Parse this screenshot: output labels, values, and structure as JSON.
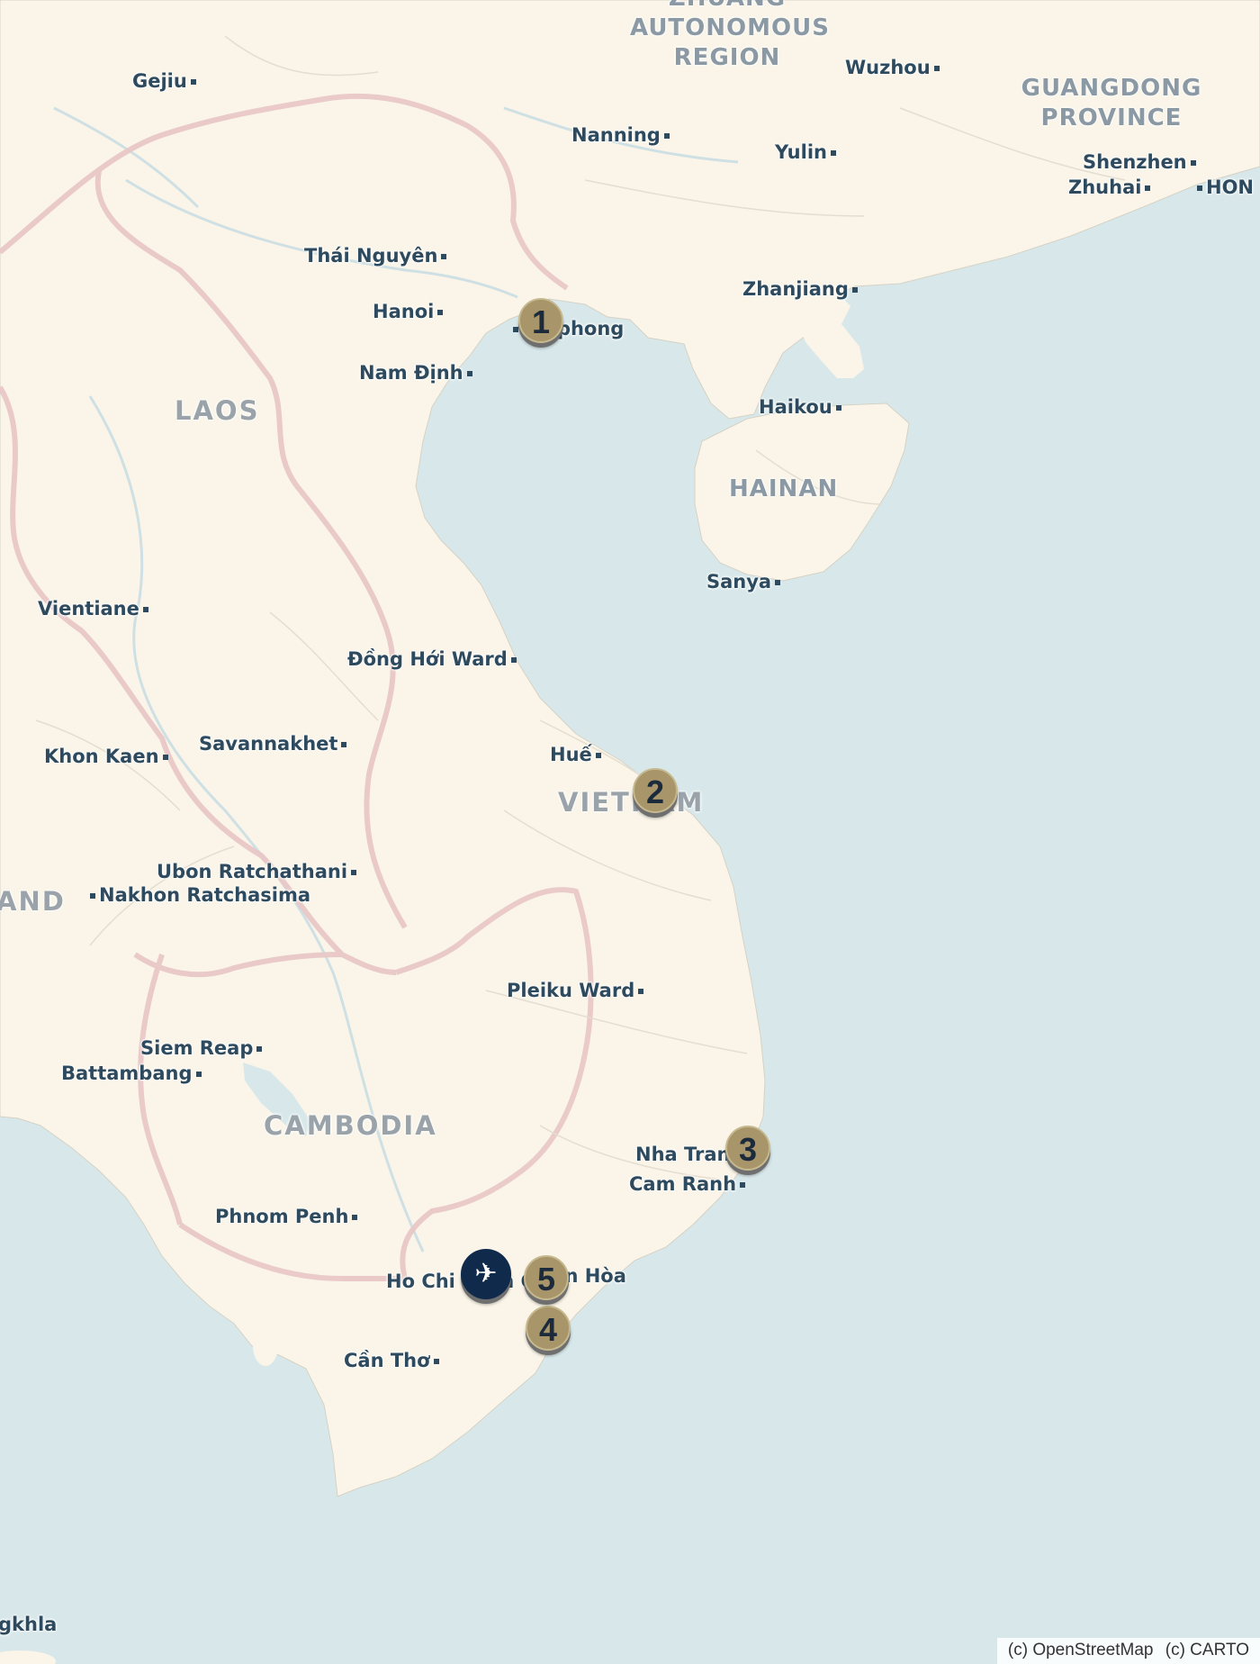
{
  "map": {
    "attribution": [
      "(c) OpenStreetMap",
      "(c) CARTO"
    ],
    "colors": {
      "land": "#faf5e8",
      "water": "#d8e8ea",
      "border": "#e8c6c6",
      "marker": "#a8956a",
      "airport": "#102a4c"
    },
    "regions": [
      {
        "name": "region-guangxi",
        "lines": [
          "ZHUANG",
          "AUTONOMOUS",
          "REGION"
        ]
      },
      {
        "name": "region-guangdong",
        "lines": [
          "GUANGDONG",
          "PROVINCE"
        ]
      },
      {
        "name": "region-hainan",
        "lines": [
          "HAINAN"
        ]
      }
    ],
    "countries": {
      "laos": "LAOS",
      "vietnam": "VIETNAM",
      "cambodia": "CAMBODIA",
      "thailand": "AND"
    },
    "cities": {
      "gejiu": "Gejiu",
      "wuzhou": "Wuzhou",
      "nanning": "Nanning",
      "yulin": "Yulin",
      "shenzhen": "Shenzhen",
      "zhuhai": "Zhuhai",
      "hongkong": "HON",
      "thai_nguyen": "Thái Nguyên",
      "zhanjiang": "Zhanjiang",
      "hanoi": "Hanoi",
      "haiphong": "Haiphong",
      "nam_dinh": "Nam Định",
      "haikou": "Haikou",
      "sanya": "Sanya",
      "vientiane": "Vientiane",
      "dong_hoi": "Đồng Hới Ward",
      "khon_kaen": "Khon Kaen",
      "savannakhet": "Savannakhet",
      "hue": "Huế",
      "ubon": "Ubon Ratchathani",
      "nakhon": "Nakhon Ratchasima",
      "pleiku": "Pleiku Ward",
      "siem_reap": "Siem Reap",
      "battambang": "Battambang",
      "nha_trang": "Nha Trang",
      "cam_ranh": "Cam Ranh",
      "phnom_penh": "Phnom Penh",
      "hcmc": "Ho Chi Minh City",
      "bien_hoa": "Biên Hòa",
      "can_tho": "Cần Thơ",
      "songkhla": "gkhla"
    },
    "markers": [
      "1",
      "2",
      "3",
      "4",
      "5"
    ],
    "airport_icon": "✈"
  }
}
